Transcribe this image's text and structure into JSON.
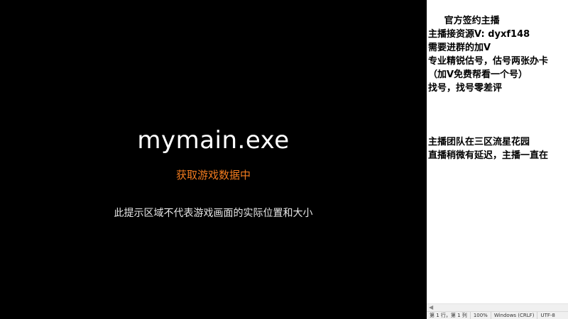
{
  "game": {
    "exe_name": "mymain.exe",
    "status": "获取游戏数据中",
    "hint": "此提示区域不代表游戏画面的实际位置和大小"
  },
  "notepad": {
    "lines": [
      "     官方签约主播",
      "主播接资源V: dyxf148",
      "需要进群的加V",
      "专业精锐估号，估号两张办卡",
      "（加V免费帮看一个号）",
      "找号，找号零差评",
      "",
      "",
      "",
      "主播团队在三区流星花园",
      "直播稍微有延迟，主播一直在"
    ],
    "statusbar": {
      "position": "第 1 行，第 1 列",
      "zoom": "100%",
      "line_ending": "Windows (CRLF)",
      "encoding": "UTF-8"
    }
  },
  "colors": {
    "status_orange": "#f07a1e",
    "background": "#000000",
    "notepad_bg": "#ffffff"
  }
}
